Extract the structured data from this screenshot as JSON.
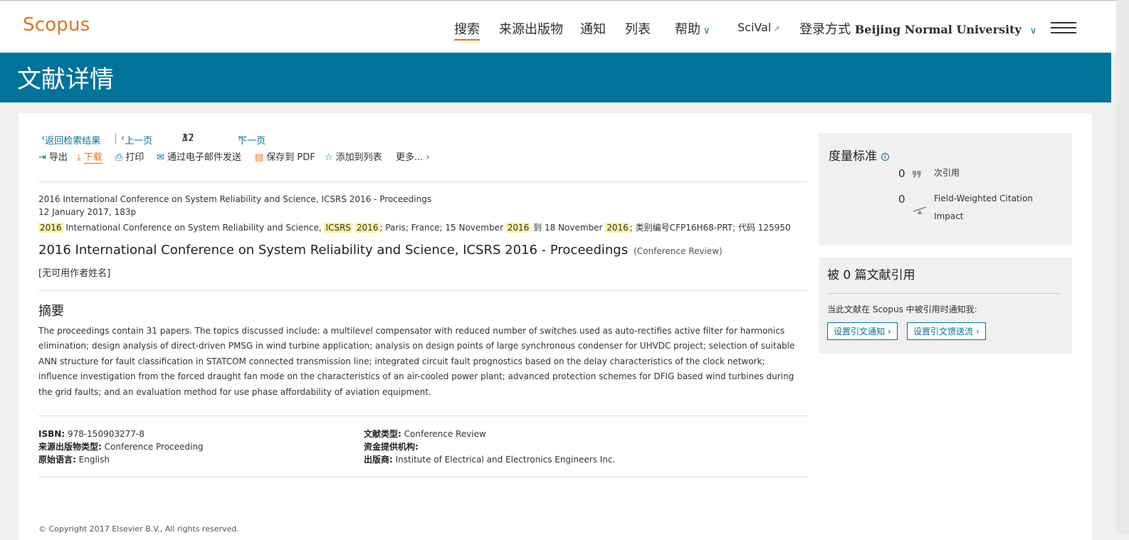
{
  "header": {
    "logo": "Scopus",
    "nav": [
      "搜索",
      "来源出版物",
      "通知",
      "列表",
      "帮助",
      "SciVal",
      "登录方式"
    ],
    "institution": "Beijing Normal University"
  },
  "banner": {
    "title": "文献详情"
  },
  "toolbar": {
    "back": "返回检索结果",
    "prev": "上一页",
    "page_current": "17",
    "page_sep": "/",
    "page_total": "32",
    "next": "下一页",
    "export": "导出",
    "download": "下载",
    "print": "打印",
    "email": "通过电子邮件发送",
    "pdf": "保存到 PDF",
    "add_list": "添加到列表",
    "more": "更多..."
  },
  "meta": {
    "source": "2016 International Conference on System Reliability and Science, ICSRS 2016 - Proceedings",
    "date": "12 January 2017, 183p",
    "conf_y1": "2016",
    "conf_a": "International Conference on System Reliability and Science,",
    "conf_icsrs": "ICSRS",
    "conf_y2": "2016",
    "conf_b": "; Paris; France; 15 November",
    "conf_y3": "2016",
    "conf_c": "到 18 November",
    "conf_y4": "2016",
    "conf_d": "; 类别编号CFP16H68-PRT; 代码 125950"
  },
  "document": {
    "title": "2016 International Conference on System Reliability and Science, ICSRS 2016 - Proceedings",
    "type": "(Conference Review)",
    "authors": "[无可用作者姓名]"
  },
  "abstract": {
    "heading": "摘要",
    "text": "The proceedings contain 31 papers. The topics discussed include: a multilevel compensator with reduced number of switches used as auto-rectifies active filter for harmonics elimination; design analysis of direct-driven PMSG in wind turbine application; analysis on design points of large synchronous condenser for UHVDC project; selection of suitable ANN structure for fault classification in STATCOM connected transmission line; integrated circuit fault prognostics based on the delay characteristics of the clock network; influence investigation from the forced draught fan mode on the characteristics of an air-cooled power plant; advanced protection schemes for DFIG based wind turbines during the grid faults; and an evaluation method for use phase affordability of aviation equipment."
  },
  "info": {
    "isbn_label": "ISBN:",
    "isbn": "978-150903277-8",
    "srctype_label": "来源出版物类型:",
    "srctype": "Conference Proceeding",
    "lang_label": "原始语言:",
    "lang": "English",
    "doctype_label": "文献类型:",
    "doctype": "Conference Review",
    "funding_label": "资金提供机构:",
    "publisher_label": "出版商:",
    "publisher": "Institute of Electrical and Electronics Engineers Inc."
  },
  "footer": {
    "copyright": "© Copyright 2017 Elsevier B.V., All rights reserved."
  },
  "metrics": {
    "heading": "度量标准",
    "citations": "0",
    "citations_label": "次引用",
    "fwci": "0",
    "fwci_label_1": "Field-Weighted Citation",
    "fwci_label_2": "Impact"
  },
  "cited": {
    "heading": "被 0 篇文献引用",
    "note": "当此文献在 Scopus 中被引用时通知我:",
    "btn_alert": "设置引文通知",
    "btn_feed": "设置引文馈送流"
  },
  "colors": {
    "brand_orange": "#e9711c",
    "banner_blue": "#00739b",
    "link_blue": "#007398",
    "highlight": "#fff19f"
  }
}
